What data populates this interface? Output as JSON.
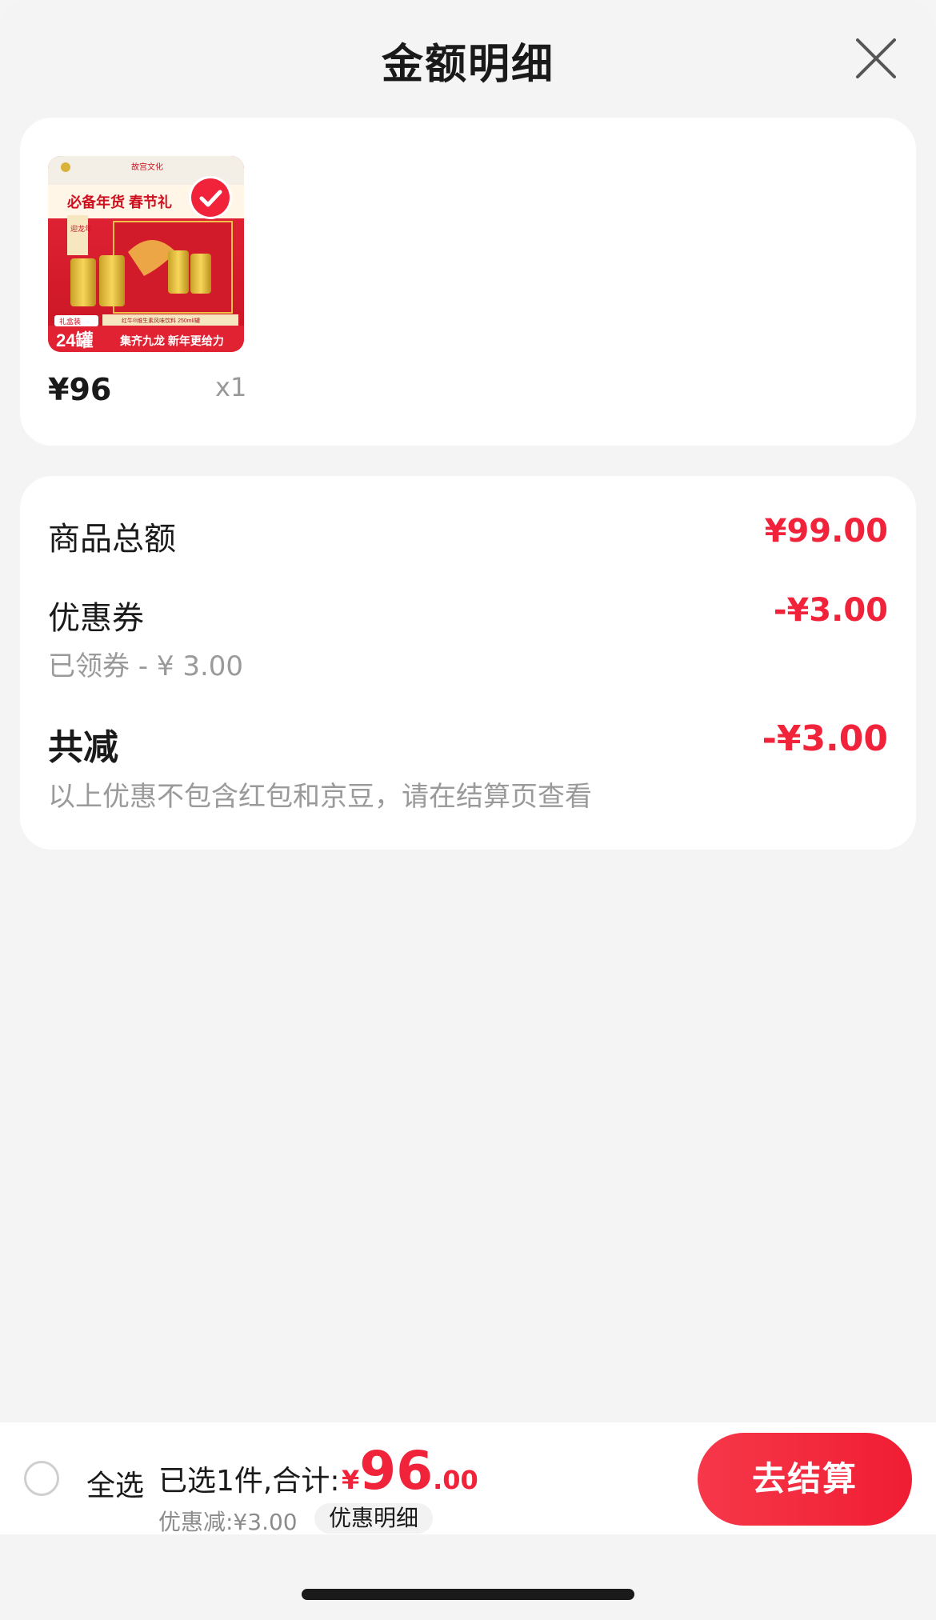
{
  "header": {
    "title": "金额明细"
  },
  "product": {
    "image_brand_text": "故宫文化",
    "image_headline": "必备年货 春节礼",
    "image_side_label": "迎龙年",
    "image_spec": "红牛®维生素风味饮料 250ml/罐",
    "image_badge_small": "礼盒装",
    "image_badge_count": "24罐",
    "image_slogan": "集齐九龙 新年更给力",
    "price": "¥96",
    "quantity": "x1"
  },
  "summary": {
    "goods_total_label": "商品总额",
    "goods_total_value": "¥99.00",
    "coupon_label": "优惠券",
    "coupon_value": "-¥3.00",
    "coupon_sub": "已领券 - ¥ 3.00",
    "total_reduce_label": "共减",
    "total_reduce_value": "-¥3.00",
    "note": "以上优惠不包含红包和京豆，请在结算页查看"
  },
  "bottom_bar": {
    "select_all": "全选",
    "selected_text": "已选1件,合计:",
    "total_yen": "¥",
    "total_int": "96",
    "total_dec": ".00",
    "discount_text": "优惠减:¥3.00",
    "detail_pill": "优惠明细",
    "checkout": "去结算"
  },
  "colors": {
    "accent": "#f0233a",
    "background": "#f4f4f4",
    "card": "#ffffff"
  },
  "icons": {
    "close": "close-icon",
    "check": "check-icon",
    "select": "radio-circle-icon"
  }
}
